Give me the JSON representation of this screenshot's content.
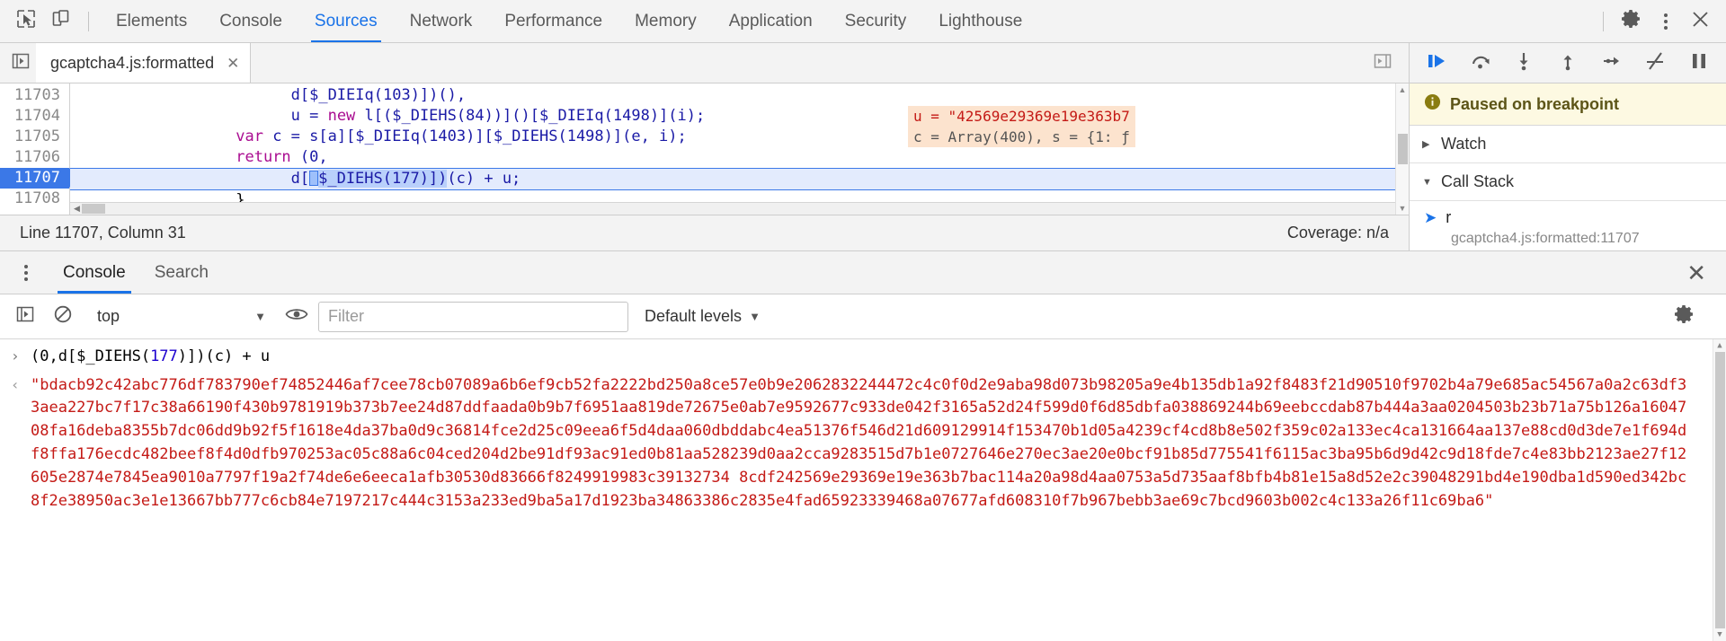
{
  "toolbar": {
    "inspect_icon": "inspect-cursor-icon",
    "device_icon": "device-toolbar-icon",
    "panels": [
      {
        "label": "Elements",
        "active": false
      },
      {
        "label": "Console",
        "active": false
      },
      {
        "label": "Sources",
        "active": true
      },
      {
        "label": "Network",
        "active": false
      },
      {
        "label": "Performance",
        "active": false
      },
      {
        "label": "Memory",
        "active": false
      },
      {
        "label": "Application",
        "active": false
      },
      {
        "label": "Security",
        "active": false
      },
      {
        "label": "Lighthouse",
        "active": false
      }
    ],
    "settings_icon": "gear-icon",
    "more_icon": "kebab-menu-icon",
    "close_icon": "close-icon"
  },
  "editor": {
    "tab_name": "gcaptcha4.js:formatted",
    "tab_close": "✕",
    "navigator_icon": "show-navigator-icon",
    "split_icon": "show-debugger-icon",
    "lines": [
      {
        "num": "11703",
        "current": false
      },
      {
        "num": "11704",
        "current": false
      },
      {
        "num": "11705",
        "current": false
      },
      {
        "num": "11706",
        "current": false
      },
      {
        "num": "11707",
        "current": true
      },
      {
        "num": "11708",
        "current": false
      }
    ],
    "code": {
      "l11703": "                        d[$_DIEIq(103)])(),",
      "l11704_a": "                        u = ",
      "l11704_kw": "new",
      "l11704_b": " l[($_DIEHS(84))]()[$_DIEIq(1498)](i);",
      "l11705_kw": "var",
      "l11705_b": " c = s[a][$_DIEIq(1403)][$_DIEHS(1498)](e, i);",
      "l11706_kw": "return",
      "l11706_b": " (0,",
      "l11707_a": "                        d[",
      "l11707_b": "$_DIEHS(177)])",
      "l11707_c": "(c) + u;",
      "l11708": "                  }"
    },
    "inline_values": [
      {
        "text": "u = \"42569e29369e19e363b7",
        "kind": "string"
      },
      {
        "text": "c = Array(400), s = {1: ƒ",
        "kind": "gray"
      }
    ],
    "status_left": "Line 11707, Column 31",
    "status_right": "Coverage: n/a"
  },
  "debugger": {
    "buttons": [
      {
        "name": "resume-script-execution",
        "icon": "resume-icon"
      },
      {
        "name": "step-over-next-function-call",
        "icon": "step-over-icon"
      },
      {
        "name": "step-into-next-function-call",
        "icon": "step-into-icon"
      },
      {
        "name": "step-out-of-current-function",
        "icon": "step-out-icon"
      },
      {
        "name": "step",
        "icon": "step-icon"
      },
      {
        "name": "deactivate-breakpoints",
        "icon": "deactivate-breakpoints-icon"
      },
      {
        "name": "pause-on-exceptions",
        "icon": "pause-icon"
      }
    ],
    "paused_banner": {
      "icon": "info-icon",
      "text": "Paused on breakpoint"
    },
    "sections": [
      {
        "label": "Watch",
        "expanded": false,
        "tri": "▶"
      },
      {
        "label": "Call Stack",
        "expanded": true,
        "tri": "▼"
      }
    ],
    "call_stack": [
      {
        "arrow": "➜",
        "function": "r",
        "location": "gcaptcha4.js:formatted:11707"
      }
    ]
  },
  "drawer": {
    "kebab_icon": "kebab-menu-icon",
    "tabs": [
      {
        "label": "Console",
        "active": true
      },
      {
        "label": "Search",
        "active": false
      }
    ],
    "close_icon": "✕",
    "console_toolbar": {
      "sidebar_icon": "show-console-sidebar-icon",
      "clear_icon": "clear-console-icon",
      "context": "top",
      "context_caret": "▼",
      "eye_icon": "live-expression-icon",
      "filter_placeholder": "Filter",
      "filter_value": "",
      "levels_label": "Default levels",
      "levels_caret": "▼",
      "settings_icon": "gear-icon"
    },
    "entries": [
      {
        "type": "input",
        "marker": "›",
        "expr_prefix": "(0,d[$_DIEHS(",
        "expr_num": "177",
        "expr_suffix": ")])(c) + u"
      },
      {
        "type": "output",
        "marker": "‹",
        "value": "\"bdacb92c42abc776df783790ef74852446af7cee78cb07089a6b6ef9cb52fa2222bd250a8ce57e0b9e2062832244472c4c0f0d2e9aba98d073b98205a9e4b135db1a92f8483f21d90510f9702b4a79e685ac54567a0a2c63df33aea227bc7f17c38a66190f430b9781919b373b7ee24d87ddfaada0b9b7f6951aa819de72675e0ab7e9592677c933de042f3165a52d24f599d0f6d85dbfa038869244b69eebccdab87b444a3aa0204503b23b71a75b126a1604708fa16deba8355b7dc06dd9b92f5f1618e4da37ba0d9c36814fce2d25c09eea6f5d4daa060dbddabc4ea51376f546d21d609129914f153470b1d05a4239cf4cd8b8e502f359c02a133ec4ca131664aa137e88cd0d3de7e1f694df8ffa176ecdc482beef8f4d0dfb970253ac05c88a6c04ced204d2be91df93ac91ed0b81aa528239d0aa2cca9283515d7b1e0727646e270ec3ae20e0bcf91b85d775541f6115ac3ba95b6d9d42c9d18fde7c4e83bb2123ae27f12605e2874e7845ea9010a7797f19a2f74de6e6eeca1afb30530d83666f8249919983c39132734 8cdf242569e29369e19e363b7bac114a20a98d4aa0753a5d735aaf8bfb4b81e15a8d52e2c39048291bd4e190dba1d590ed342bc8f2e38950ac3e1e13667bb777c6cb84e7197217c444c3153a233ed9ba5a17d1923ba34863386c2835e4fad65923339468a07677afd608310f7b967bebb3ae69c7bcd9603b002c4c133a26f11c69ba6\""
      }
    ]
  }
}
